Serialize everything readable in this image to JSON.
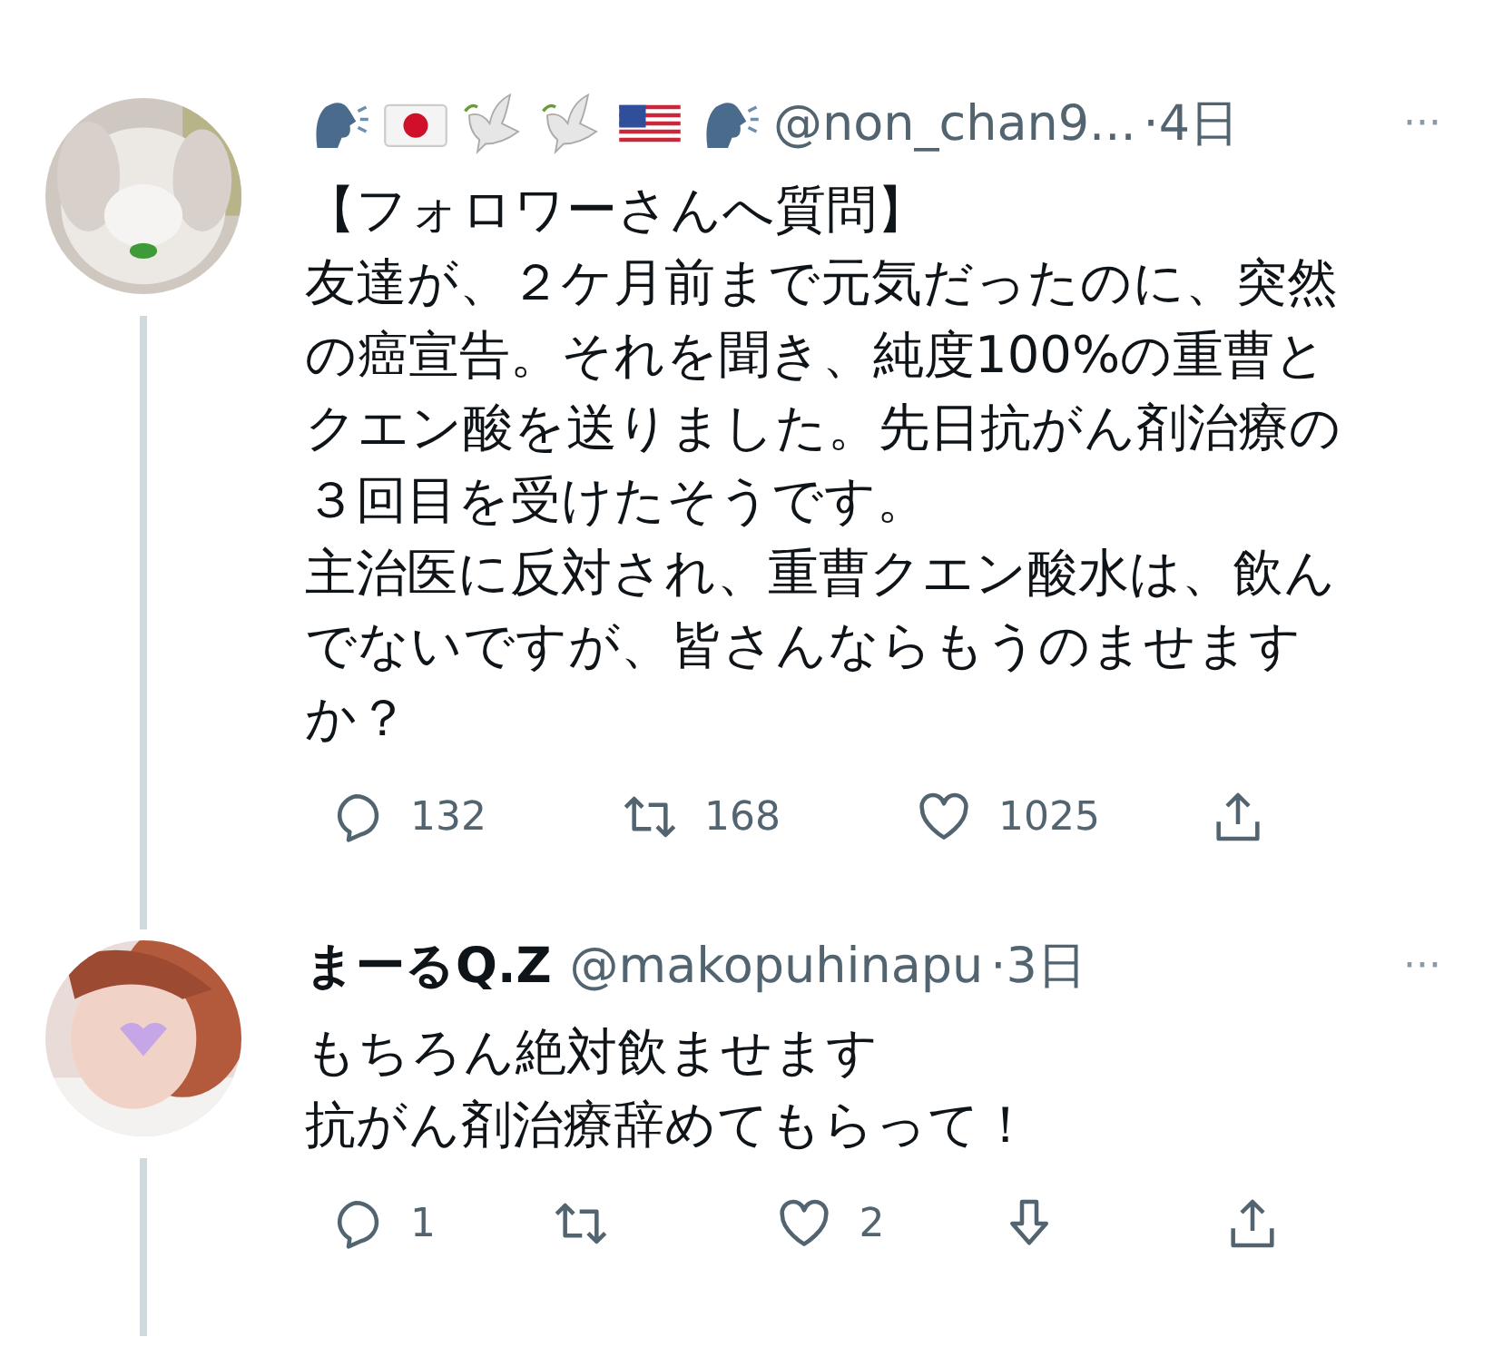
{
  "tweets": [
    {
      "avatar": {
        "kind": "picture"
      },
      "name_icons": [
        {
          "kind": "speaking-head"
        },
        {
          "kind": "flag-japan"
        },
        {
          "kind": "dove"
        },
        {
          "kind": "dove"
        },
        {
          "kind": "flag-usa"
        },
        {
          "kind": "speaking-head"
        }
      ],
      "handle": "@non_chan9...",
      "time": "·4日",
      "more": "···",
      "lines": [
        "【フォロワーさんへ質問】",
        "友達が、２ケ月前まで元気だったのに、突然",
        "の癌宣告。それを聞き、純度100%の重曹と",
        "クエン酸を送りました。先日抗がん剤治療の",
        "３回目を受けたそうです。",
        "主治医に反対され、重曹クエン酸水は、飲ん",
        "でないですが、皆さんならもうのませます",
        "か？"
      ],
      "actions": [
        {
          "kind": "reply",
          "count": "132"
        },
        {
          "kind": "retweet",
          "count": "168"
        },
        {
          "kind": "like",
          "count": "1025"
        },
        {
          "kind": "share"
        }
      ]
    },
    {
      "avatar": {
        "kind": "picture"
      },
      "display_name": "まーるQ.Z",
      "handle": "@makopuhinapu",
      "time": "·3日",
      "more": "···",
      "lines": [
        "もちろん絶対飲ませます",
        "抗がん剤治療辞めてもらって！"
      ],
      "actions": [
        {
          "kind": "reply",
          "count": "1"
        },
        {
          "kind": "retweet"
        },
        {
          "kind": "like",
          "count": "2"
        },
        {
          "kind": "download"
        },
        {
          "kind": "share"
        }
      ]
    }
  ]
}
